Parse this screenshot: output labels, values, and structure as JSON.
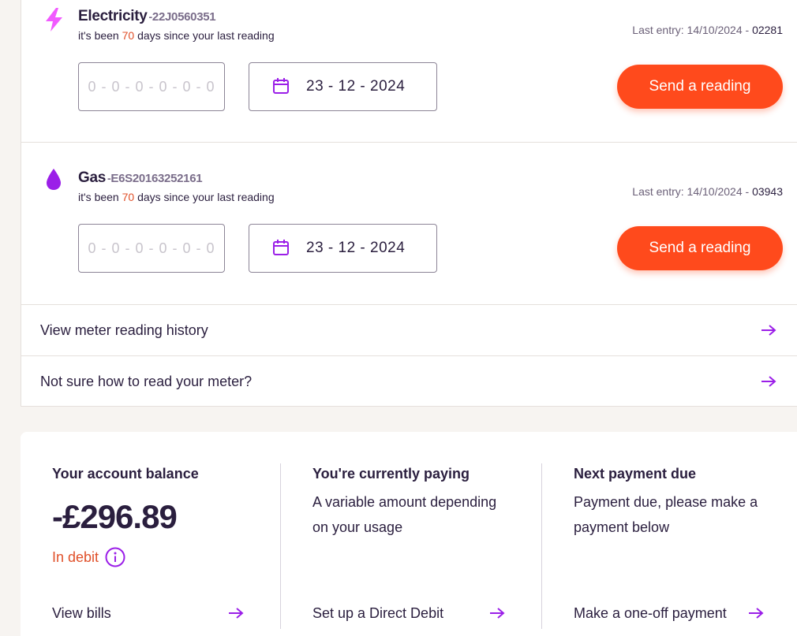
{
  "meters": [
    {
      "type": "Electricity",
      "icon": "lightning-bolt-icon",
      "separator": "-",
      "serial": "22J0560351",
      "since_prefix": "it's been ",
      "days": "70",
      "since_suffix": " days since your last reading",
      "last_entry_label": "Last entry: 14/10/2024",
      "last_entry_sep": " - ",
      "last_entry_value": "02281",
      "reading_placeholder": "0 - 0 - 0 - 0 - 0 - 0",
      "date": "23 - 12 - 2024",
      "send_label": "Send a reading"
    },
    {
      "type": "Gas",
      "icon": "flame-drop-icon",
      "separator": "-",
      "serial": "E6S20163252161",
      "since_prefix": "it's been ",
      "days": "70",
      "since_suffix": " days since your last reading",
      "last_entry_label": "Last entry: 14/10/2024",
      "last_entry_sep": " - ",
      "last_entry_value": "03943",
      "reading_placeholder": "0 - 0 - 0 - 0 - 0 - 0",
      "date": "23 - 12 - 2024",
      "send_label": "Send a reading"
    }
  ],
  "links": {
    "history": "View meter reading history",
    "how_to_read": "Not sure how to read your meter?"
  },
  "balance": {
    "title": "Your account balance",
    "amount": "-£296.89",
    "status": "In debit",
    "link": "View bills"
  },
  "paying": {
    "title": "You're currently paying",
    "text_line1": "A variable amount depending",
    "text_line2": "on your usage",
    "link": "Set up a Direct Debit"
  },
  "next_payment": {
    "title": "Next payment due",
    "text_line1": "Payment due, please make a",
    "text_line2": "payment below",
    "link": "Make a one-off payment"
  },
  "colors": {
    "accent": "#ff4a1c",
    "purple": "#9b1fe8",
    "text": "#2a1e3e",
    "debit": "#e0502a"
  }
}
